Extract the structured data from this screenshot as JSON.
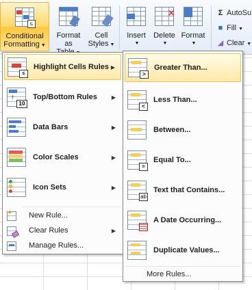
{
  "ribbon": {
    "conditional_formatting": {
      "line1": "Conditional",
      "line2": "Formatting",
      "icon": "conditional-formatting-icon"
    },
    "format_as_table": {
      "line1": "Format",
      "line2": "as Table",
      "icon": "format-as-table-icon"
    },
    "cell_styles": {
      "line1": "Cell",
      "line2": "Styles",
      "icon": "cell-styles-icon"
    },
    "insert": {
      "label": "Insert",
      "icon": "insert-cells-icon"
    },
    "delete": {
      "label": "Delete",
      "icon": "delete-cells-icon"
    },
    "format": {
      "label": "Format",
      "icon": "format-cells-icon"
    },
    "autosum": {
      "label": "AutoSu",
      "glyph": "Σ",
      "icon": "autosum-icon"
    },
    "fill": {
      "label": "Fill",
      "icon": "fill-icon"
    },
    "clear": {
      "label": "Clear",
      "icon": "clear-icon"
    }
  },
  "main_menu": {
    "items": [
      {
        "label": "Highlight Cells Rules",
        "icon": "highlight-cells-rules-icon",
        "has_submenu": true,
        "highlighted": true
      },
      {
        "label": "Top/Bottom Rules",
        "icon": "top-bottom-rules-icon",
        "has_submenu": true
      },
      {
        "label": "Data Bars",
        "icon": "data-bars-icon",
        "has_submenu": true
      },
      {
        "label": "Color Scales",
        "icon": "color-scales-icon",
        "has_submenu": true
      },
      {
        "label": "Icon Sets",
        "icon": "icon-sets-icon",
        "has_submenu": true
      }
    ],
    "commands": [
      {
        "label": "New Rule...",
        "icon": "new-rule-icon"
      },
      {
        "label": "Clear Rules",
        "icon": "clear-rules-icon",
        "has_submenu": true
      },
      {
        "label": "Manage Rules...",
        "icon": "manage-rules-icon"
      }
    ]
  },
  "sub_menu": {
    "items": [
      {
        "label": "Greater Than...",
        "icon": "greater-than-icon",
        "highlighted": true
      },
      {
        "label": "Less Than...",
        "icon": "less-than-icon"
      },
      {
        "label": "Between...",
        "icon": "between-icon"
      },
      {
        "label": "Equal To...",
        "icon": "equal-to-icon"
      },
      {
        "label": "Text that Contains...",
        "icon": "text-contains-icon"
      },
      {
        "label": "A Date Occurring...",
        "icon": "date-occurring-icon"
      },
      {
        "label": "Duplicate Values...",
        "icon": "duplicate-values-icon"
      }
    ],
    "more": "More Rules..."
  },
  "colors": {
    "highlight_fill": "#ffe9a8",
    "highlight_border": "#e5c365",
    "ribbon_bg": "#e4ecf7"
  }
}
